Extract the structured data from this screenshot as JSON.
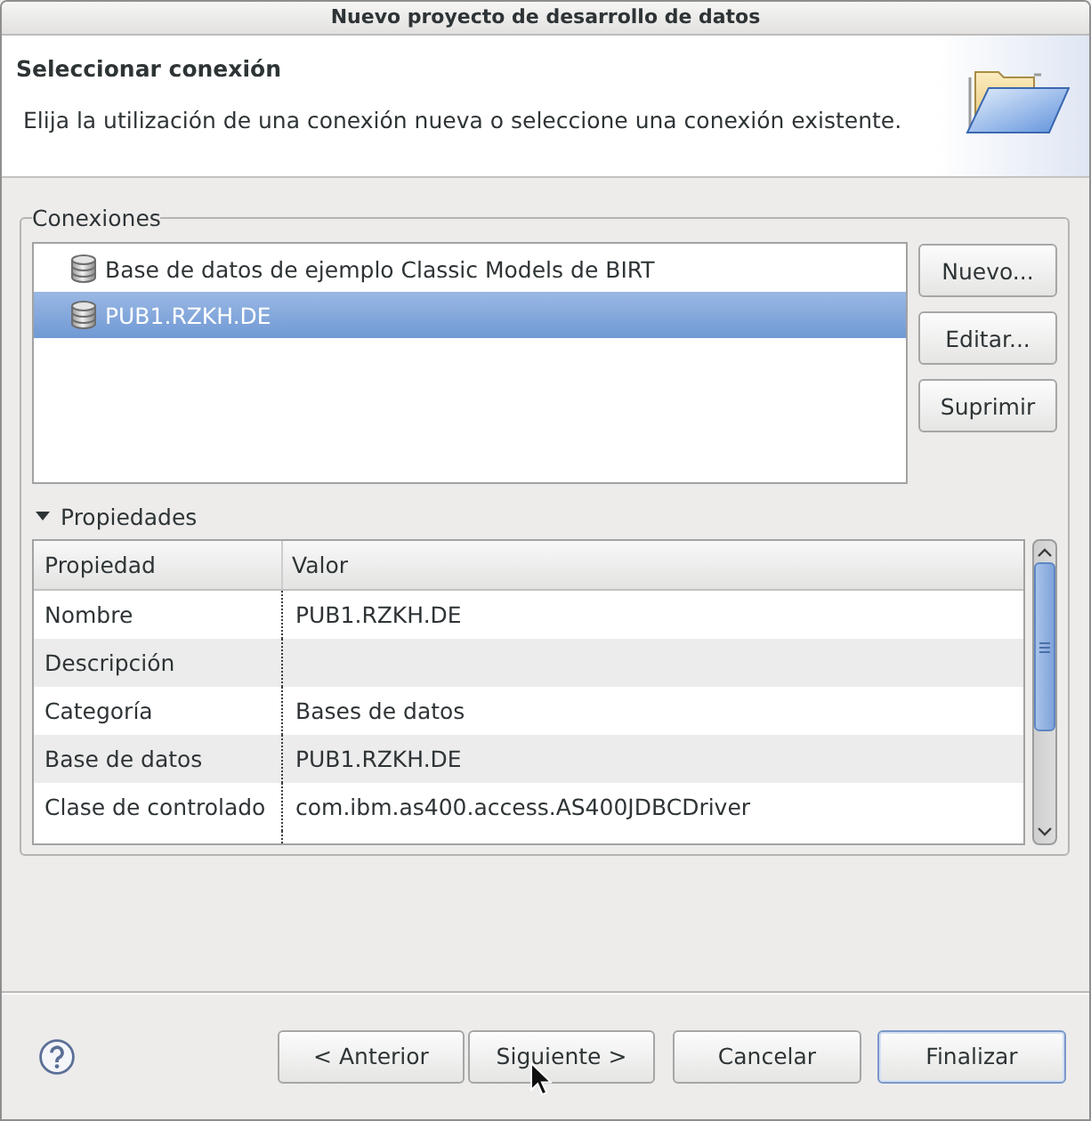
{
  "window": {
    "title": "Nuevo proyecto de desarrollo de datos"
  },
  "header": {
    "title": "Seleccionar conexión",
    "description": "Elija la utilización de una conexión nueva o seleccione una conexión existente."
  },
  "connections": {
    "label": "Conexiones",
    "items": [
      {
        "label": "Base de datos de ejemplo Classic Models de BIRT",
        "selected": false
      },
      {
        "label": "PUB1.RZKH.DE",
        "selected": true
      }
    ],
    "buttons": [
      "Nuevo...",
      "Editar...",
      "Suprimir"
    ]
  },
  "properties": {
    "label": "Propiedades",
    "expanded": true,
    "columns": [
      "Propiedad",
      "Valor"
    ],
    "rows": [
      {
        "property": "Nombre",
        "value": "PUB1.RZKH.DE"
      },
      {
        "property": "Descripción"
      },
      {
        "property": "Categoría",
        "value": "Bases de datos"
      },
      {
        "property": "Base de datos",
        "value": "PUB1.RZKH.DE"
      },
      {
        "property": "Clase de controlado",
        "value": "com.ibm.as400.access.AS400JDBCDriver"
      }
    ]
  },
  "navigation_buttons": [
    {
      "label": "< Anterior",
      "default": false
    },
    {
      "label": "Siguiente >",
      "default": false
    }
  ],
  "buttons": [
    {
      "label": "Cancelar",
      "default": false
    },
    {
      "label": "Finalizar",
      "default": true
    }
  ]
}
